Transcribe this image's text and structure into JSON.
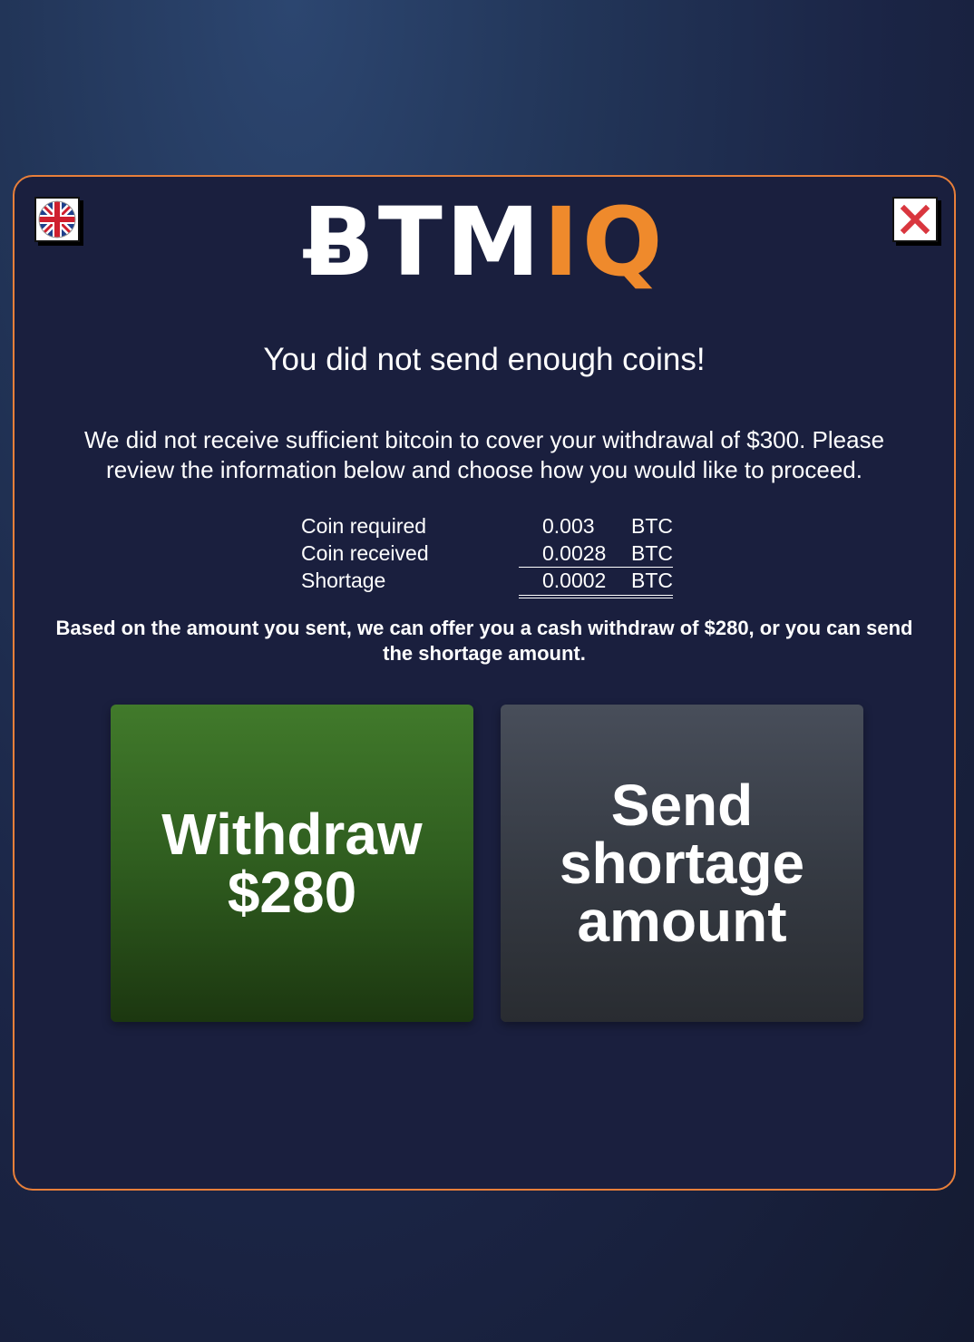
{
  "brand": {
    "logo_prefix": "ɃTM",
    "logo_suffix": "IQ",
    "colors": {
      "accent": "#ef8a2c",
      "border": "#e87f3a",
      "panel": "#1a1f3e"
    }
  },
  "header": {
    "language_icon": "uk-flag-icon",
    "close_icon": "close-icon"
  },
  "dialog": {
    "title": "You did not send enough coins!",
    "message": "We did not receive sufficient bitcoin to cover your withdrawal of $300. Please review the information below and choose how you would like to proceed.",
    "summary": [
      {
        "label": "Coin required",
        "value": "0.003",
        "unit": "BTC"
      },
      {
        "label": "Coin received",
        "value": "0.0028",
        "unit": "BTC"
      },
      {
        "label": "Shortage",
        "value": "0.0002",
        "unit": "BTC"
      }
    ],
    "offer": "Based on the amount you sent, we can offer you a cash withdraw of $280, or you can send the shortage amount."
  },
  "actions": {
    "withdraw": {
      "line1": "Withdraw",
      "line2": "$280",
      "color": "#2f5d1f"
    },
    "send_shortage": {
      "line1": "Send",
      "line2": "shortage",
      "line3": "amount",
      "color": "#363b44"
    }
  }
}
